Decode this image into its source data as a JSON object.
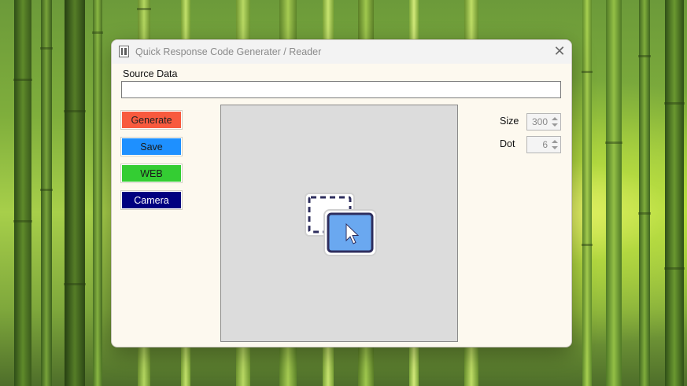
{
  "window": {
    "title": "Quick Response Code Generater / Reader",
    "close_glyph": "✕"
  },
  "source": {
    "label": "Source Data",
    "value": "",
    "placeholder": ""
  },
  "buttons": {
    "generate": "Generate",
    "save": "Save",
    "web": "WEB",
    "camera": "Camera"
  },
  "settings": {
    "size_label": "Size",
    "size_value": "300",
    "dot_label": "Dot",
    "dot_value": "6"
  },
  "icons": {
    "app": "qr-code-icon",
    "drop_area": "drag-and-drop-cursor-icon",
    "close": "close-icon"
  },
  "colors": {
    "generate_button": "#f85a3e",
    "save_button": "#1e90ff",
    "web_button": "#34cd33",
    "camera_button": "#000080",
    "window_background": "#fdf9ef",
    "canvas_background": "#dcdcdc"
  }
}
